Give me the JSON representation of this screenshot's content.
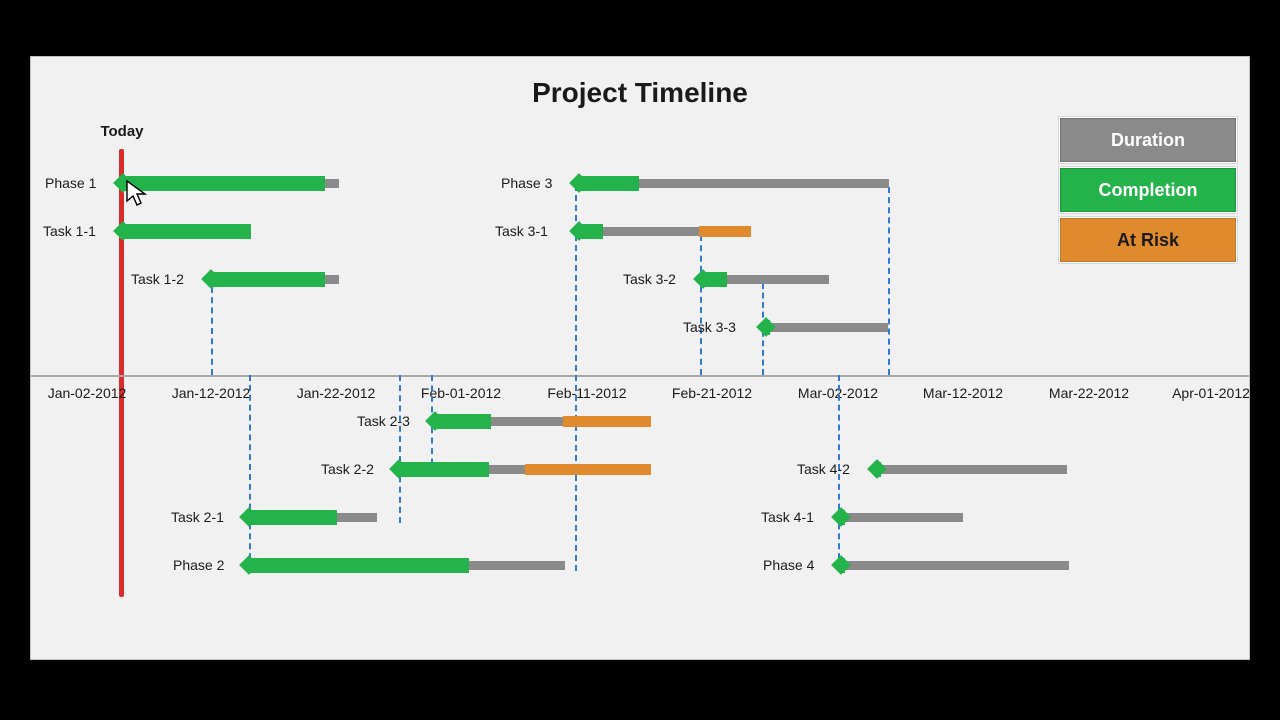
{
  "title": "Project Timeline",
  "today_label": "Today",
  "legend": {
    "duration": "Duration",
    "completion": "Completion",
    "at_risk": "At Risk"
  },
  "axis_ticks": [
    "Jan-02-2012",
    "Jan-12-2012",
    "Jan-22-2012",
    "Feb-01-2012",
    "Feb-11-2012",
    "Feb-21-2012",
    "Mar-02-2012",
    "Mar-12-2012",
    "Mar-22-2012",
    "Apr-01-2012"
  ],
  "chart_data": {
    "type": "gantt",
    "title": "Project Timeline",
    "x_axis": "date",
    "x_range": [
      "2012-01-02",
      "2012-04-01"
    ],
    "today": "2012-01-03",
    "legend": [
      "Duration",
      "Completion",
      "At Risk"
    ],
    "colors": {
      "duration": "#8a8a8a",
      "completion": "#24b34b",
      "at_risk": "#e08a2e",
      "today_line": "#dc2b2b"
    },
    "tasks": [
      {
        "label": "Phase 1",
        "lane": 0,
        "start": "2012-01-03",
        "end": "2012-01-20",
        "completion_end": "2012-01-19",
        "risk_start": null
      },
      {
        "label": "Task 1-1",
        "lane": 1,
        "start": "2012-01-03",
        "end": "2012-01-13",
        "completion_end": "2012-01-13",
        "risk_start": null
      },
      {
        "label": "Task 1-2",
        "lane": 2,
        "start": "2012-01-10",
        "end": "2012-01-20",
        "completion_end": "2012-01-19",
        "risk_start": null
      },
      {
        "label": "Phase 3",
        "lane": 0,
        "start": "2012-02-08",
        "end": "2012-03-04",
        "completion_end": "2012-02-13",
        "risk_start": null
      },
      {
        "label": "Task 3-1",
        "lane": 1,
        "start": "2012-02-08",
        "end": "2012-02-22",
        "completion_end": "2012-02-10",
        "risk_start": "2012-02-19"
      },
      {
        "label": "Task 3-2",
        "lane": 2,
        "start": "2012-02-19",
        "end": "2012-02-29",
        "completion_end": "2012-02-21",
        "risk_start": null
      },
      {
        "label": "Task 3-3",
        "lane": 3,
        "start": "2012-02-24",
        "end": "2012-03-04",
        "completion_end": "2012-02-24",
        "risk_start": null
      },
      {
        "label": "Task 2-3",
        "lane": 4,
        "start": "2012-01-29",
        "end": "2012-02-14",
        "completion_end": "2012-02-02",
        "risk_start": "2012-02-08"
      },
      {
        "label": "Task 2-2",
        "lane": 5,
        "start": "2012-01-26",
        "end": "2012-02-14",
        "completion_end": "2012-02-02",
        "risk_start": "2012-02-05"
      },
      {
        "label": "Task 2-1",
        "lane": 6,
        "start": "2012-01-13",
        "end": "2012-01-23",
        "completion_end": "2012-01-20",
        "risk_start": null
      },
      {
        "label": "Phase 2",
        "lane": 7,
        "start": "2012-01-13",
        "end": "2012-02-08",
        "completion_end": "2012-01-31",
        "risk_start": null
      },
      {
        "label": "Task 4-2",
        "lane": 5,
        "start": "2012-03-03",
        "end": "2012-03-18",
        "completion_end": "2012-03-03",
        "risk_start": null
      },
      {
        "label": "Task 4-1",
        "lane": 6,
        "start": "2012-03-01",
        "end": "2012-03-12",
        "completion_end": "2012-03-01",
        "risk_start": null
      },
      {
        "label": "Phase 4",
        "lane": 7,
        "start": "2012-03-01",
        "end": "2012-03-20",
        "completion_end": "2012-03-01",
        "risk_start": null
      }
    ],
    "dependencies": [
      {
        "from": "Task 1-2",
        "to": "Task 2-1"
      },
      {
        "from": "Task 2-1",
        "to": "Task 2-2"
      },
      {
        "from": "Task 2-2",
        "to": "Task 2-3"
      },
      {
        "from": "Phase 2",
        "to": "Phase 3"
      },
      {
        "from": "Task 3-1",
        "to": "Task 3-2"
      },
      {
        "from": "Task 3-2",
        "to": "Task 3-3"
      },
      {
        "from": "Phase 3",
        "to": "Phase 4"
      }
    ]
  }
}
